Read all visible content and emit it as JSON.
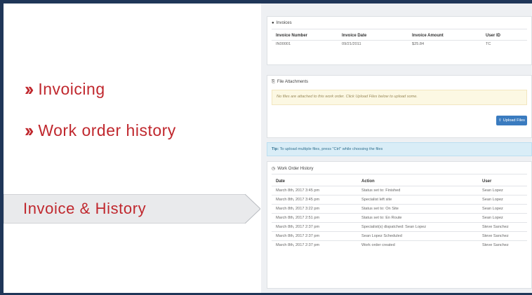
{
  "left": {
    "bullets": [
      {
        "label": "Invoicing"
      },
      {
        "label": "Work order history"
      }
    ],
    "banner": "Invoice & History"
  },
  "colors": {
    "frame": "#1f3658",
    "accent": "#c0282e",
    "banner_bg": "#e9eaec",
    "button": "#3a7bbf"
  },
  "invoices": {
    "title": "Invoices",
    "icon": "pin-icon",
    "columns": [
      "Invoice Number",
      "Invoice Date",
      "Invoice Amount",
      "User ID"
    ],
    "rows": [
      [
        "IN00001",
        "09/21/2011",
        "$25.84",
        "TC"
      ]
    ]
  },
  "attachments": {
    "title": "File Attachments",
    "icon": "paperclip-icon",
    "warning": "No files are attached to this work order. Click Upload Files below to upload some.",
    "upload_label": "Upload Files"
  },
  "tip": {
    "bold": "Tip:",
    "text": "To upload multiple files, press \"Ctrl\" while choosing the files"
  },
  "history": {
    "title": "Work Order History",
    "icon": "clock-icon",
    "columns": [
      "Date",
      "Action",
      "User"
    ],
    "rows": [
      [
        "March 8th, 2017 3:45 pm",
        "Status set to: Finished",
        "Sean Lopez"
      ],
      [
        "March 8th, 2017 3:45 pm",
        "Specialist left site",
        "Sean Lopez"
      ],
      [
        "March 8th, 2017 3:22 pm",
        "Status set to: On Site",
        "Sean Lopez"
      ],
      [
        "March 8th, 2017 2:51 pm",
        "Status set to: En Route",
        "Sean Lopez"
      ],
      [
        "March 8th, 2017 2:37 pm",
        "Specialist(s) dispatched: Sean Lopez",
        "Steve Sanchez"
      ],
      [
        "March 8th, 2017 2:37 pm",
        "Sean Lopez Scheduled",
        "Steve Sanchez"
      ],
      [
        "March 8th, 2017 2:37 pm",
        "Work order created",
        "Steve Sanchez"
      ]
    ]
  }
}
